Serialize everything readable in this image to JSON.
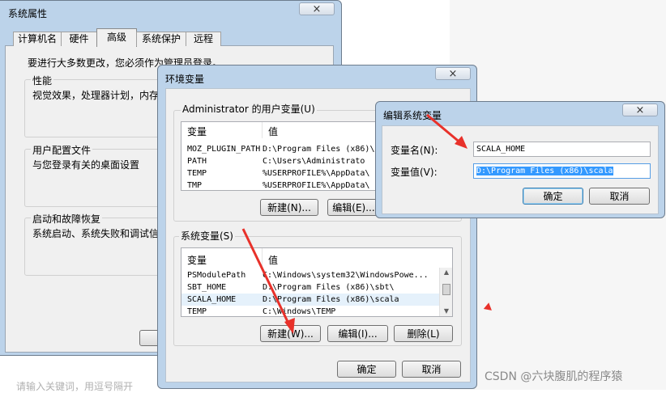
{
  "sys_props": {
    "title": "系统属性",
    "close": "×",
    "tabs": [
      "计算机名",
      "硬件",
      "高级",
      "系统保护",
      "远程"
    ],
    "admin_note": "要进行大多数更改，您必须作为管理员登录。",
    "perf_label": "性能",
    "perf_text": "视觉效果，处理器计划，内存",
    "profile_label": "用户配置文件",
    "profile_text": "与您登录有关的桌面设置",
    "startup_label": "启动和故障恢复",
    "startup_text": "系统启动、系统失败和调试信"
  },
  "env_vars": {
    "title": "环境变量",
    "close": "×",
    "user_label": "Administrator 的用户变量(U)",
    "col_var": "变量",
    "col_val": "值",
    "user_rows": [
      {
        "name": "MOZ_PLUGIN_PATH",
        "value": "D:\\Program Files (x86)\\"
      },
      {
        "name": "PATH",
        "value": "C:\\Users\\Administrato"
      },
      {
        "name": "TEMP",
        "value": "%USERPROFILE%\\AppData\\"
      },
      {
        "name": "TMP",
        "value": "%USERPROFILE%\\AppData\\"
      }
    ],
    "user_new": "新建(N)...",
    "user_edit": "编辑(E)...",
    "sys_label": "系统变量(S)",
    "sys_rows": [
      {
        "name": "PSModulePath",
        "value": "C:\\Windows\\system32\\WindowsPowe..."
      },
      {
        "name": "SBT_HOME",
        "value": "D:\\Program Files (x86)\\sbt\\"
      },
      {
        "name": "SCALA_HOME",
        "value": "D:\\Program Files (x86)\\scala"
      },
      {
        "name": "TEMP",
        "value": "C:\\Windows\\TEMP"
      }
    ],
    "sys_new": "新建(W)...",
    "sys_edit": "编辑(I)...",
    "sys_delete": "删除(L)",
    "ok": "确定",
    "cancel": "取消"
  },
  "edit_var": {
    "title": "编辑系统变量",
    "close": "×",
    "name_label": "变量名(N):",
    "name_value": "SCALA_HOME",
    "value_label": "变量值(V):",
    "value_value": "D:\\Program Files (x86)\\scala",
    "ok": "确定",
    "cancel": "取消"
  },
  "background": {
    "search_hint": "请输入关键词，用逗号隔开",
    "watermark": "CSDN @六块腹肌的程序猿"
  },
  "colors": {
    "arrow": "#e8312a",
    "selection": "#3399ff"
  }
}
